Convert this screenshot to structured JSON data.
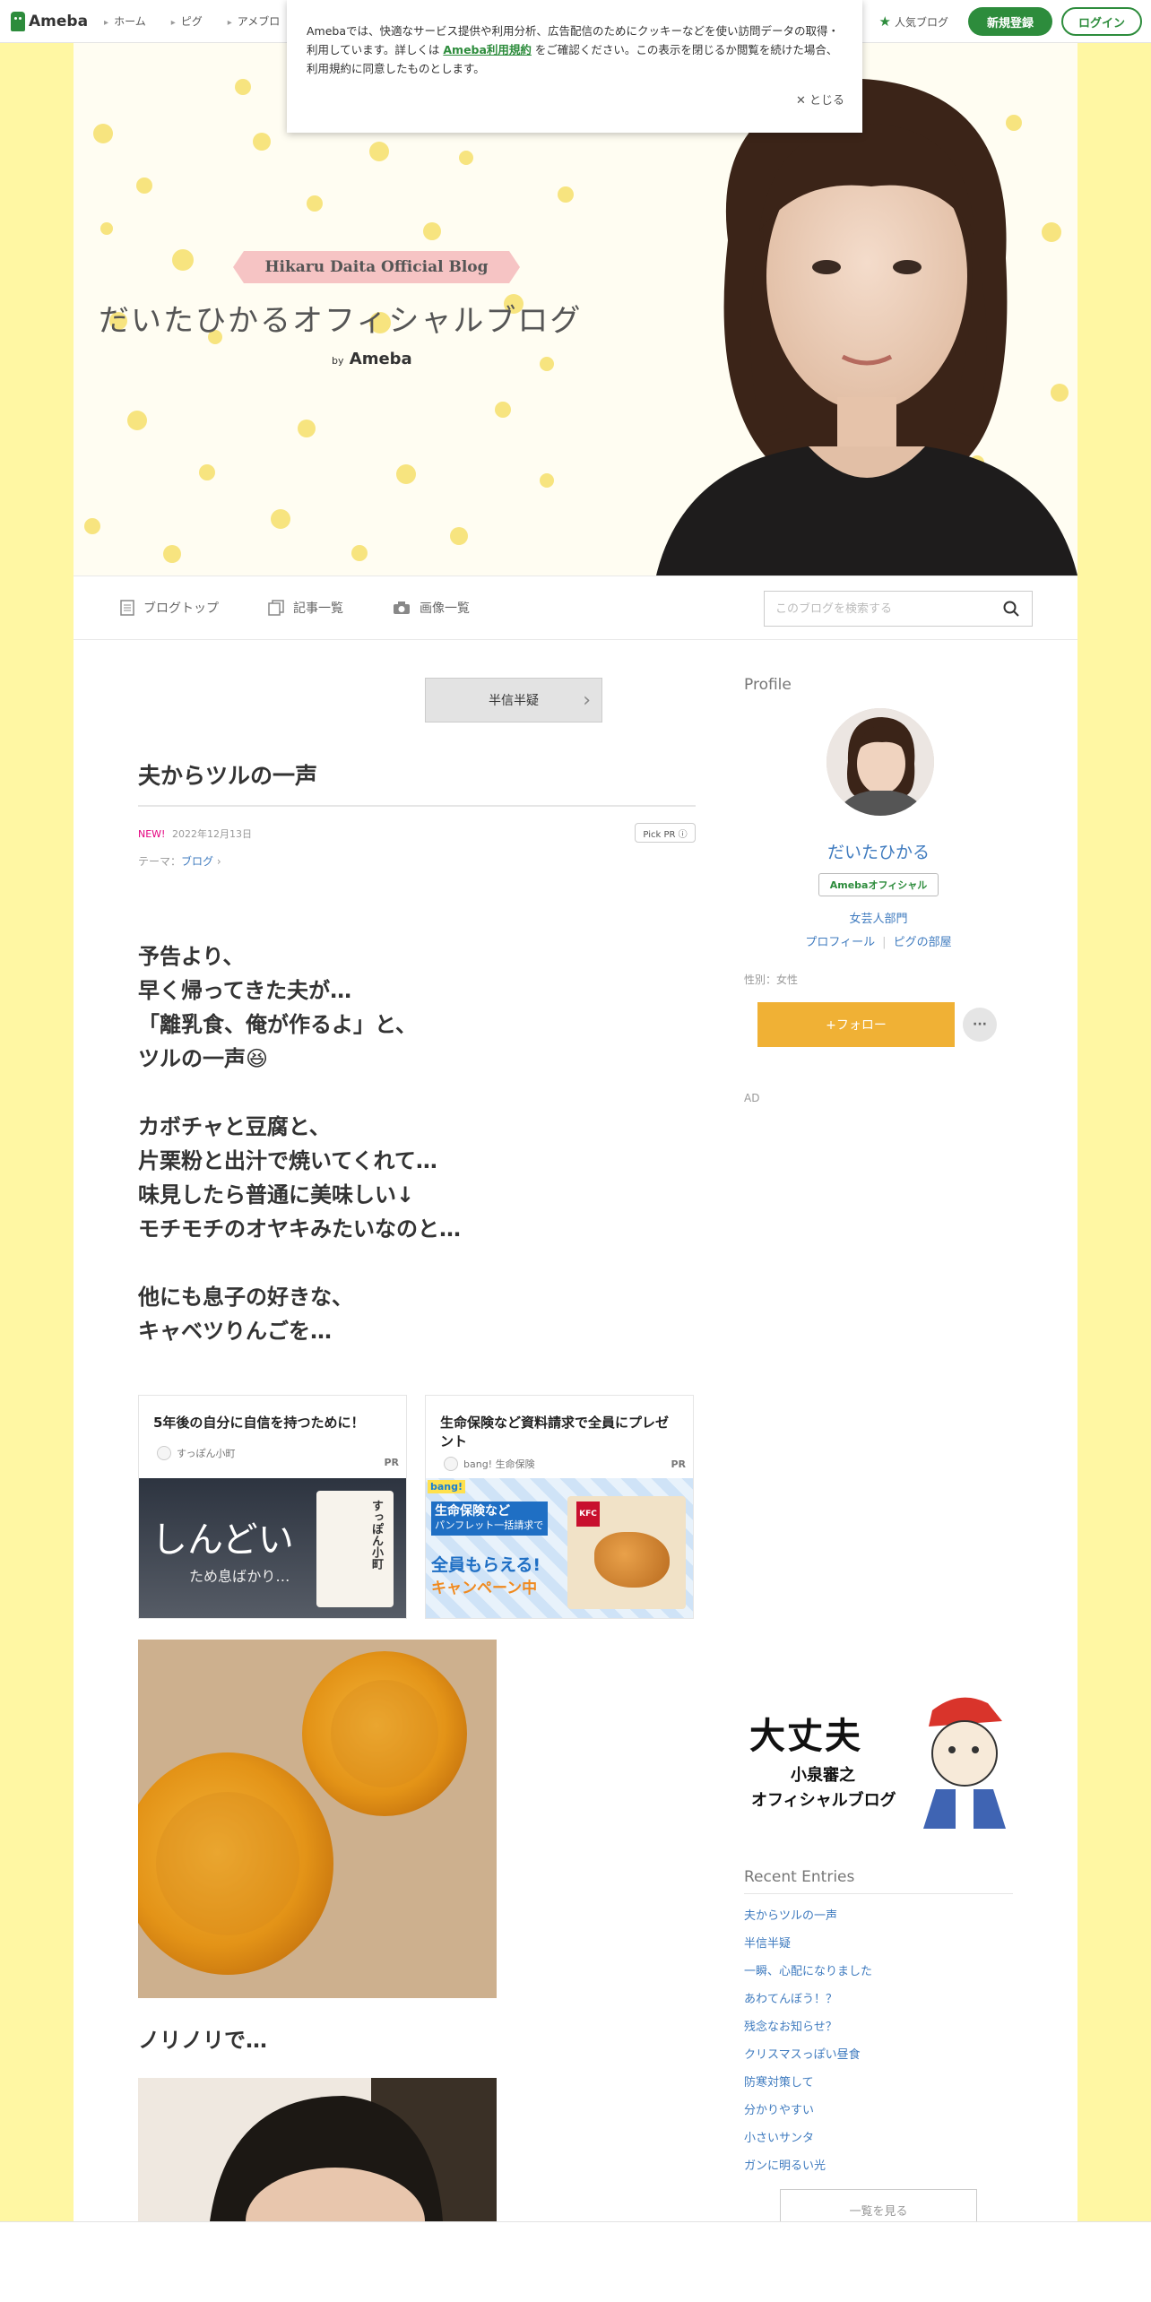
{
  "topbar": {
    "logo": "Ameba",
    "nav": [
      "ホーム",
      "ピグ",
      "アメブロ"
    ],
    "popular": "人気ブログ",
    "signup": "新規登録",
    "login": "ログイン"
  },
  "cookie": {
    "text_before": "Amebaでは、快適なサービス提供や利用分析、広告配信のためにクッキーなどを使い訪問データの取得・利用しています。詳しくは",
    "link": "Ameba利用規約",
    "text_after": "をご確認ください。この表示を閉じるか閲覧を続けた場合、利用規約に同意したものとします。",
    "close": "✕ とじる"
  },
  "banner": {
    "ribbon": "Hikaru Daita Official Blog",
    "title": "だいたひかるオフィシャルブログ",
    "by": "by",
    "ameba": "Ameba"
  },
  "subnav": {
    "items": [
      "ブログトップ",
      "記事一覧",
      "画像一覧"
    ],
    "search_placeholder": "このブログを検索する"
  },
  "article": {
    "prev_label": "半信半疑",
    "title": "夫からツルの一声",
    "new": "NEW!",
    "date": "2022年12月13日",
    "pickpr": "Pick PR ⓘ",
    "theme_label": "テーマ：",
    "theme": "ブログ",
    "para1": [
      "予告より、",
      "早く帰ってきた夫が…",
      "「離乳食、俺が作るよ」と、",
      "ツルの一声😆"
    ],
    "para2": [
      "カボチャと豆腐と、",
      "片栗粉と出汁で焼いてくれて…",
      "味見したら普通に美味しい↓",
      "モチモチのオヤキみたいなのと…"
    ],
    "para3": [
      "他にも息子の好きな、",
      "キャベツりんごを…"
    ],
    "caption": "ノリノリで…"
  },
  "ads": [
    {
      "title": "5年後の自分に自信を持つために！",
      "advertiser": "すっぽん小町",
      "pr": "PR",
      "img_big": "しんどい",
      "img_small": "ため息ばかり…",
      "img_product": "すっぽん小町"
    },
    {
      "title": "生命保険など資料請求で全員にプレゼント",
      "advertiser": "bang! 生命保険",
      "pr": "PR",
      "img_l1": "生命保険など",
      "img_l2": "パンフレット一括請求で",
      "img_l3": "全員もらえる!",
      "img_l4": "キャンペーン中",
      "img_brand": "KFC",
      "img_logo": "bang!"
    }
  ],
  "sidebar": {
    "profile_h": "Profile",
    "name": "だいたひかる",
    "official": "Amebaオフィシャル",
    "genre": "女芸人部門",
    "links": [
      "プロフィール",
      "ピグの部屋"
    ],
    "gender": "性別：女性",
    "follow": "+フォロー",
    "more": "···",
    "ad": "AD",
    "banner_l1": "大丈夫",
    "banner_l2": "小泉審之",
    "banner_l3": "オフィシャルブログ",
    "recent_h": "Recent Entries",
    "recent": [
      "夫からツルの一声",
      "半信半疑",
      "一瞬、心配になりました",
      "あわてんぼう！？",
      "残念なお知らせ？",
      "クリスマスっぽい昼食",
      "防寒対策して",
      "分かりやすい",
      "小さいサンタ",
      "ガンに明るい光"
    ],
    "see_all": "一覧を見る"
  },
  "colors": {
    "accent": "#2d8c3c",
    "link": "#3f7bbf",
    "follow": "#f0b135",
    "side_bg": "#fff7a3"
  }
}
